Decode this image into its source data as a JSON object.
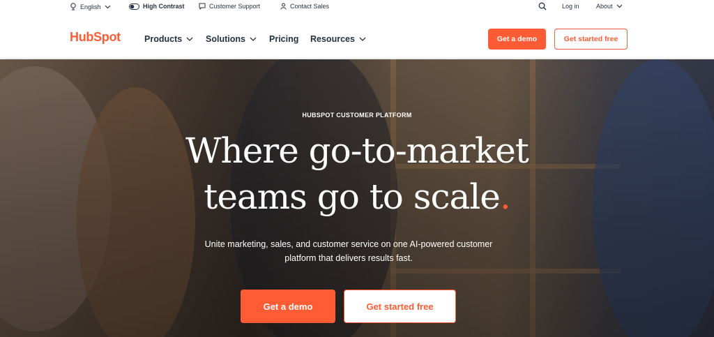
{
  "utility": {
    "language": "English",
    "high_contrast": "High Contrast",
    "support": "Customer Support",
    "sales": "Contact Sales",
    "login": "Log in",
    "about": "About"
  },
  "nav": {
    "logo": "HubSpot",
    "items": [
      "Products",
      "Solutions",
      "Pricing",
      "Resources"
    ],
    "demo": "Get a demo",
    "start": "Get started free"
  },
  "hero": {
    "eyebrow": "HUBSPOT CUSTOMER PLATFORM",
    "headline_line1": "Where go-to-market",
    "headline_line2": "teams go to scale",
    "headline_dot": ".",
    "subtext": "Unite marketing, sales, and customer service on one AI-powered customer platform that delivers results fast.",
    "demo": "Get a demo",
    "start": "Get started free"
  },
  "colors": {
    "brand": "#ff5c35",
    "text": "#213343"
  }
}
